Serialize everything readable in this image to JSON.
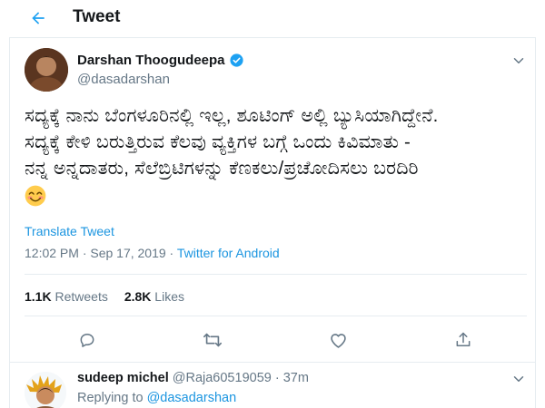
{
  "header": {
    "title": "Tweet",
    "back_icon": "arrow-left-icon"
  },
  "colors": {
    "accent": "#1b95e0",
    "text": "#14171a",
    "muted": "#657786",
    "like": "#e0245e",
    "verified": "#1da1f2"
  },
  "tweet": {
    "author_name": "Darshan Thoogudeepa",
    "author_handle": "@dasadarshan",
    "text_lines": [
      "ಸದ್ಯಕ್ಕೆ ನಾನು ಬೆಂಗಳೂರಿನಲ್ಲಿ ಇಲ್ಲ, ಶೂಟಿಂಗ್ ಅಲ್ಲಿ ಬ್ಯುಸಿಯಾಗಿದ್ದೇನೆ.",
      "ಸದ್ಯಕ್ಕೆ ಕೇಳಿ ಬರುತ್ತಿರುವ ಕೆಲವು ವ್ಯಕ್ತಿಗಳ ಬಗ್ಗೆ ಒಂದು ಕಿವಿಮಾತು -",
      "ನನ್ನ ಅನ್ನದಾತರು, ಸೆಲೆಬ್ರಿಟಿಗಳನ್ನು ಕೆಣಕಲು/ಪ್ರಚೋದಿಸಲು ಬರದಿರಿ"
    ],
    "emoji": "smiling-face-emoji",
    "translate_label": "Translate Tweet",
    "timestamp": "12:02 PM · Sep 17, 2019 · ",
    "source": "Twitter for Android",
    "retweets_count": "1.1K",
    "retweets_label": "Retweets",
    "likes_count": "2.8K",
    "likes_label": "Likes"
  },
  "actions": [
    "reply-icon",
    "retweet-icon",
    "like-icon",
    "share-icon"
  ],
  "reply": {
    "name": "sudeep michel",
    "handle": "@Raja60519059",
    "time": " · 37m",
    "replying_prefix": "Replying to ",
    "replying_to": "@dasadarshan"
  }
}
